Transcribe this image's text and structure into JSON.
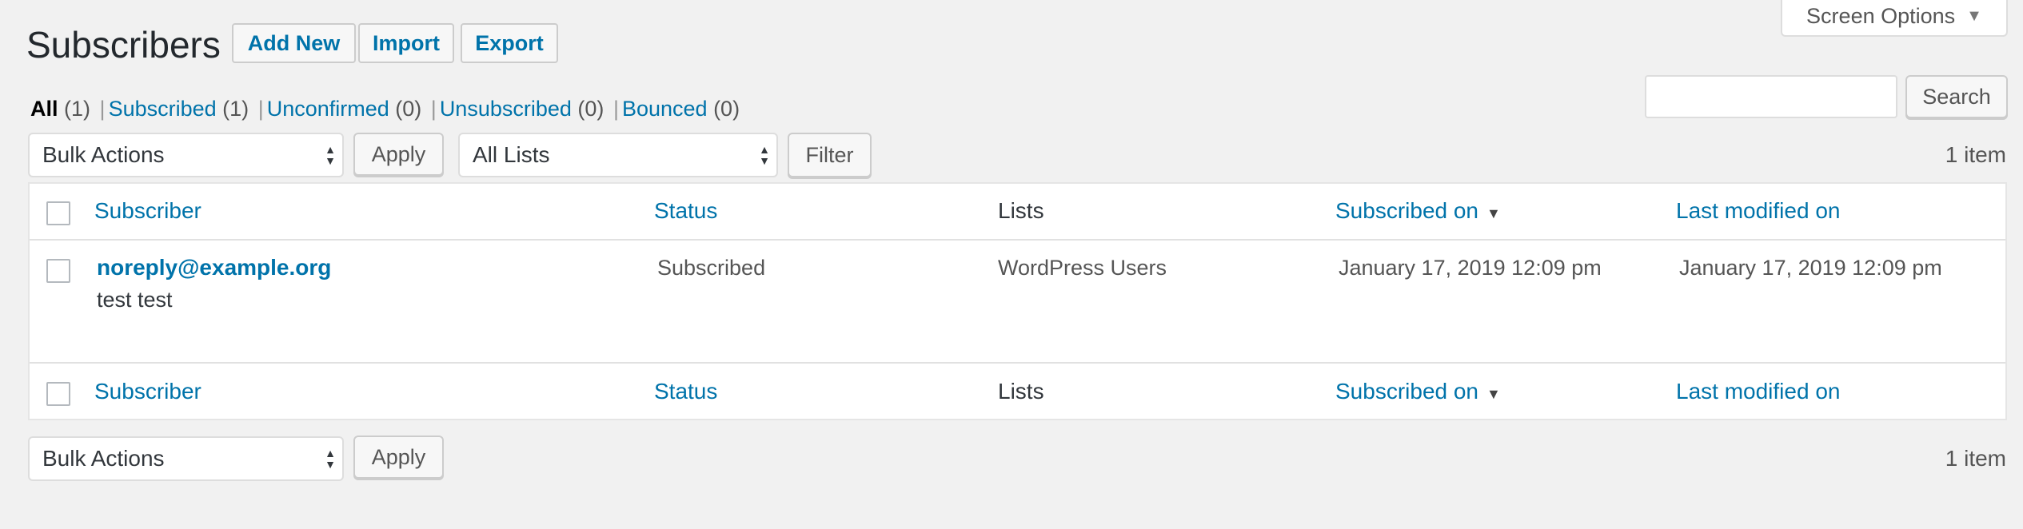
{
  "header": {
    "title": "Subscribers",
    "buttons": {
      "add_new": "Add New",
      "import": "Import",
      "export": "Export"
    },
    "screen_options": "Screen Options"
  },
  "views": [
    {
      "label": "All",
      "count": "(1)",
      "current": true
    },
    {
      "label": "Subscribed",
      "count": "(1)"
    },
    {
      "label": "Unconfirmed",
      "count": "(0)"
    },
    {
      "label": "Unsubscribed",
      "count": "(0)"
    },
    {
      "label": "Bounced",
      "count": "(0)"
    }
  ],
  "search": {
    "value": "",
    "button": "Search"
  },
  "top_nav": {
    "bulk_actions": "Bulk Actions",
    "apply": "Apply",
    "list_filter": "All Lists",
    "filter": "Filter",
    "items_count": "1 item"
  },
  "table": {
    "columns": [
      "Subscriber",
      "Status",
      "Lists",
      "Subscribed on",
      "Last modified on"
    ],
    "rows": [
      {
        "email": "noreply@example.org",
        "name": "test test",
        "status": "Subscribed",
        "lists": "WordPress Users",
        "subscribed_on": "January 17, 2019 12:09 pm",
        "last_modified_on": "January 17, 2019 12:09 pm"
      }
    ]
  },
  "bottom_nav": {
    "bulk_actions": "Bulk Actions",
    "apply": "Apply",
    "items_count": "1 item"
  },
  "colors": {
    "link": "#0073aa",
    "background": "#f1f1f1"
  }
}
